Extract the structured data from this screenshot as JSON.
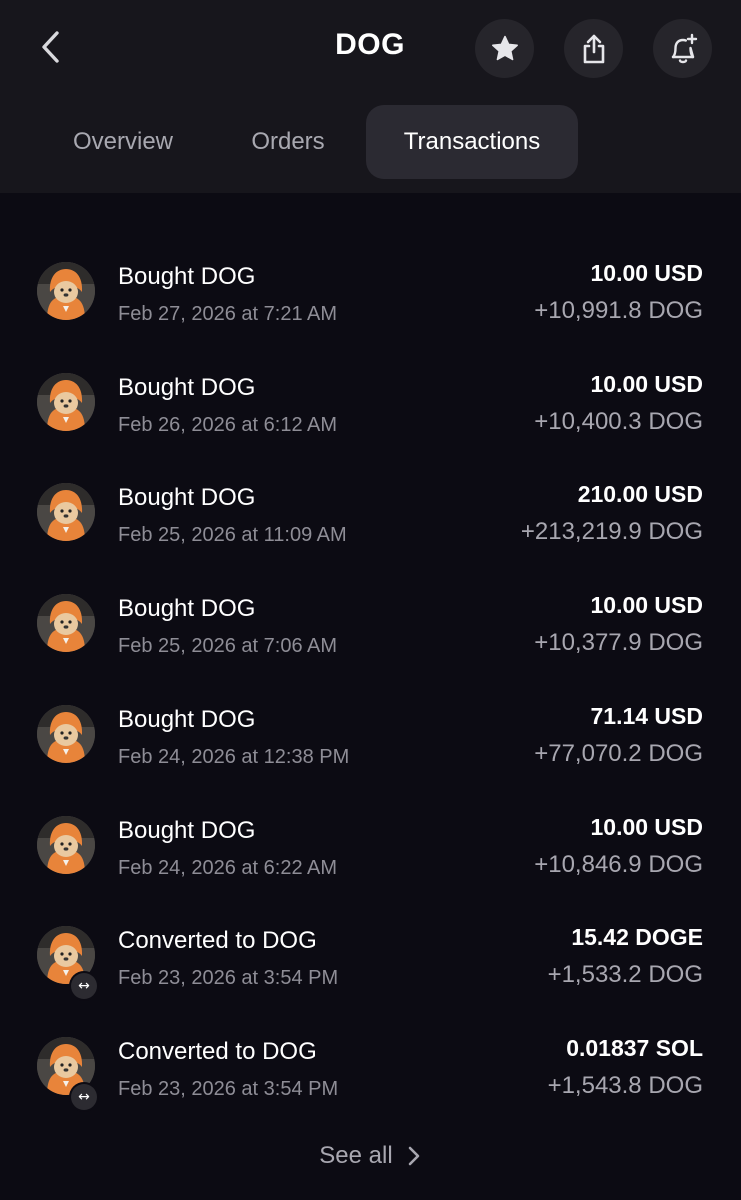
{
  "header": {
    "title": "DOG",
    "back_icon": "chevron-left-icon",
    "actions": [
      {
        "name": "favorite-button",
        "icon": "star-icon"
      },
      {
        "name": "share-button",
        "icon": "share-icon"
      },
      {
        "name": "add-alert-button",
        "icon": "bell-plus-icon"
      }
    ]
  },
  "tabs": [
    {
      "label": "Overview",
      "active": false
    },
    {
      "label": "Orders",
      "active": false
    },
    {
      "label": "Transactions",
      "active": true
    }
  ],
  "transactions": [
    {
      "title": "Bought DOG",
      "date": "Feb 27, 2026 at 7:21 AM",
      "amount": "10.00 USD",
      "received": "+10,991.8 DOG",
      "type": "buy"
    },
    {
      "title": "Bought DOG",
      "date": "Feb 26, 2026 at 6:12 AM",
      "amount": "10.00 USD",
      "received": "+10,400.3 DOG",
      "type": "buy"
    },
    {
      "title": "Bought DOG",
      "date": "Feb 25, 2026 at 11:09 AM",
      "amount": "210.00 USD",
      "received": "+213,219.9 DOG",
      "type": "buy"
    },
    {
      "title": "Bought DOG",
      "date": "Feb 25, 2026 at 7:06 AM",
      "amount": "10.00 USD",
      "received": "+10,377.9 DOG",
      "type": "buy"
    },
    {
      "title": "Bought DOG",
      "date": "Feb 24, 2026 at 12:38 PM",
      "amount": "71.14 USD",
      "received": "+77,070.2 DOG",
      "type": "buy"
    },
    {
      "title": "Bought DOG",
      "date": "Feb 24, 2026 at 6:22 AM",
      "amount": "10.00 USD",
      "received": "+10,846.9 DOG",
      "type": "buy"
    },
    {
      "title": "Converted to DOG",
      "date": "Feb 23, 2026 at 3:54 PM",
      "amount": "15.42 DOGE",
      "received": "+1,533.2 DOG",
      "type": "convert"
    },
    {
      "title": "Converted to DOG",
      "date": "Feb 23, 2026 at 3:54 PM",
      "amount": "0.01837 SOL",
      "received": "+1,543.8 DOG",
      "type": "convert"
    }
  ],
  "see_all": {
    "label": "See all",
    "icon": "chevron-right-icon"
  },
  "colors": {
    "background": "#0c0b13",
    "header_background": "#17161c",
    "active_tab": "#2b2a32",
    "secondary_text": "#8e8d96",
    "avatar_accent": "#e8843a"
  }
}
